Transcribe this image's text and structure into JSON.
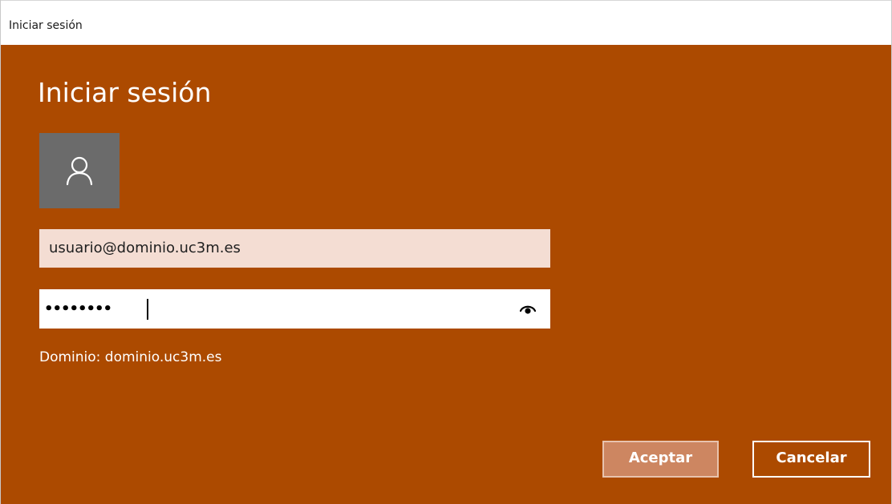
{
  "window": {
    "title": "Iniciar sesión"
  },
  "dialog": {
    "heading": "Iniciar sesión",
    "avatar_icon": "user-icon",
    "username_value": "usuario@dominio.uc3m.es",
    "password_masked": "••••••••",
    "reveal_icon": "eye-icon",
    "domain_label": "Dominio: dominio.uc3m.es",
    "accept_label": "Aceptar",
    "cancel_label": "Cancelar"
  },
  "colors": {
    "accent_background": "#ac4a00",
    "username_field": "#f4ddd3",
    "avatar_tile": "#6b6b6b",
    "accept_button": "#cd8661"
  }
}
